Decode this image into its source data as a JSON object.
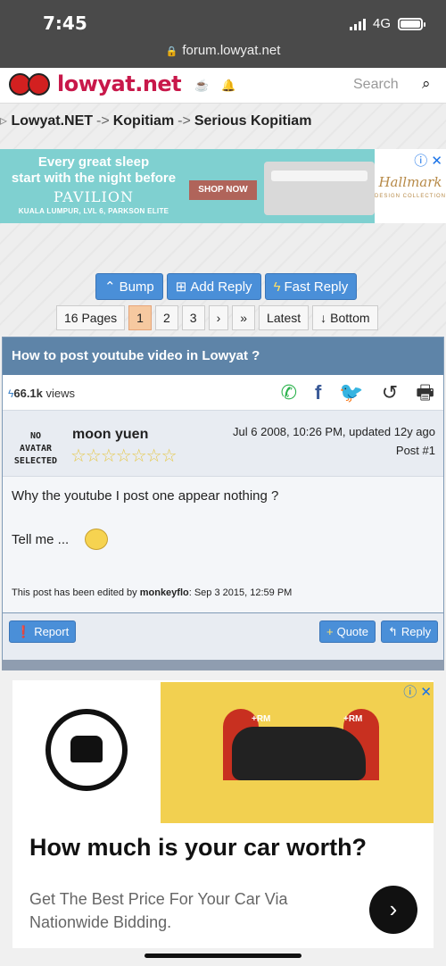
{
  "status_bar": {
    "time": "7:45",
    "network": "4G",
    "url": "forum.lowyat.net"
  },
  "header": {
    "logo_text": "lowyat.net",
    "search_placeholder": "Search"
  },
  "breadcrumb": [
    "Lowyat.NET",
    "Kopitiam",
    "Serious Kopitiam"
  ],
  "breadcrumb_sep": "->",
  "ad_banner": {
    "line1": "Every great sleep",
    "line2": "start with the night before",
    "brand": "PAVILION",
    "location": "KUALA LUMPUR, LVL 6, PARKSON ELITE",
    "cta": "SHOP NOW",
    "sponsor": "Hallmark",
    "sponsor_sub": "DESIGN COLLECTION"
  },
  "actions": {
    "bump": "Bump",
    "add_reply": "Add Reply",
    "fast_reply": "Fast Reply"
  },
  "pagination": {
    "pages_label": "16 Pages",
    "pages": [
      "1",
      "2",
      "3"
    ],
    "current": "1",
    "latest": "Latest",
    "bottom": "Bottom"
  },
  "topic": {
    "title": "How to post youtube video in Lowyat ?",
    "views_count": "66.1k",
    "views_label": "views"
  },
  "post": {
    "avatar_text": "NO AVATAR SELECTED",
    "author": "moon yuen",
    "date": "Jul 6 2008, 10:26 PM, updated 12y ago",
    "number": "Post #1",
    "body_line1": "Why the youtube I post one appear nothing ?",
    "body_line2": "Tell me ...",
    "edited_prefix": "This post has been edited by",
    "edited_by": "monkeyflo",
    "edited_date": ": Sep 3 2015, 12:59 PM",
    "report": "Report",
    "quote": "Quote",
    "reply": "Reply"
  },
  "car_ad": {
    "title": "How much is your car worth?",
    "subtitle": "Get The Best Price For Your Car Via Nationwide Bidding.",
    "badge_left": "+RM",
    "badge_right": "+RM"
  },
  "colors": {
    "header_bar": "#5e84a8",
    "accent_blue": "#4a8fd8",
    "brand_red": "#c8184a",
    "page_active": "#f6c9a0"
  }
}
